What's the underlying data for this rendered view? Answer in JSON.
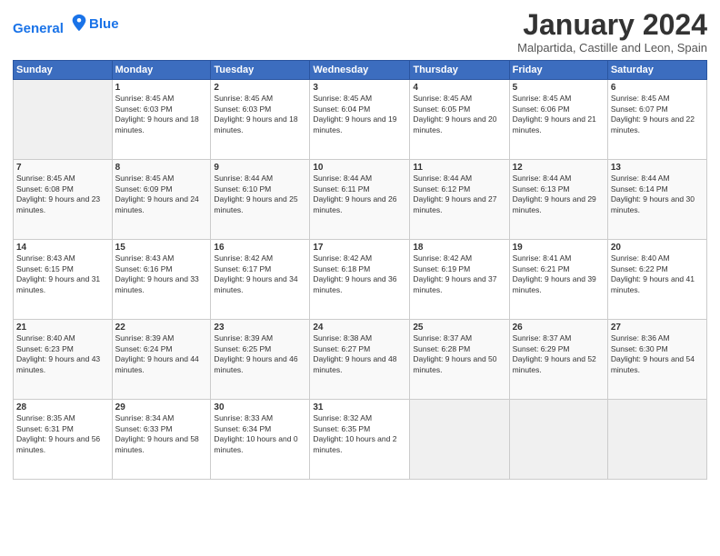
{
  "logo": {
    "line1": "General",
    "line2": "Blue"
  },
  "title": "January 2024",
  "subtitle": "Malpartida, Castille and Leon, Spain",
  "weekdays": [
    "Sunday",
    "Monday",
    "Tuesday",
    "Wednesday",
    "Thursday",
    "Friday",
    "Saturday"
  ],
  "weeks": [
    [
      {
        "day": "",
        "sunrise": "",
        "sunset": "",
        "daylight": ""
      },
      {
        "day": "1",
        "sunrise": "8:45 AM",
        "sunset": "6:03 PM",
        "daylight": "9 hours and 18 minutes."
      },
      {
        "day": "2",
        "sunrise": "8:45 AM",
        "sunset": "6:03 PM",
        "daylight": "9 hours and 18 minutes."
      },
      {
        "day": "3",
        "sunrise": "8:45 AM",
        "sunset": "6:04 PM",
        "daylight": "9 hours and 19 minutes."
      },
      {
        "day": "4",
        "sunrise": "8:45 AM",
        "sunset": "6:05 PM",
        "daylight": "9 hours and 20 minutes."
      },
      {
        "day": "5",
        "sunrise": "8:45 AM",
        "sunset": "6:06 PM",
        "daylight": "9 hours and 21 minutes."
      },
      {
        "day": "6",
        "sunrise": "8:45 AM",
        "sunset": "6:07 PM",
        "daylight": "9 hours and 22 minutes."
      }
    ],
    [
      {
        "day": "7",
        "sunrise": "8:45 AM",
        "sunset": "6:08 PM",
        "daylight": "9 hours and 23 minutes."
      },
      {
        "day": "8",
        "sunrise": "8:45 AM",
        "sunset": "6:09 PM",
        "daylight": "9 hours and 24 minutes."
      },
      {
        "day": "9",
        "sunrise": "8:44 AM",
        "sunset": "6:10 PM",
        "daylight": "9 hours and 25 minutes."
      },
      {
        "day": "10",
        "sunrise": "8:44 AM",
        "sunset": "6:11 PM",
        "daylight": "9 hours and 26 minutes."
      },
      {
        "day": "11",
        "sunrise": "8:44 AM",
        "sunset": "6:12 PM",
        "daylight": "9 hours and 27 minutes."
      },
      {
        "day": "12",
        "sunrise": "8:44 AM",
        "sunset": "6:13 PM",
        "daylight": "9 hours and 29 minutes."
      },
      {
        "day": "13",
        "sunrise": "8:44 AM",
        "sunset": "6:14 PM",
        "daylight": "9 hours and 30 minutes."
      }
    ],
    [
      {
        "day": "14",
        "sunrise": "8:43 AM",
        "sunset": "6:15 PM",
        "daylight": "9 hours and 31 minutes."
      },
      {
        "day": "15",
        "sunrise": "8:43 AM",
        "sunset": "6:16 PM",
        "daylight": "9 hours and 33 minutes."
      },
      {
        "day": "16",
        "sunrise": "8:42 AM",
        "sunset": "6:17 PM",
        "daylight": "9 hours and 34 minutes."
      },
      {
        "day": "17",
        "sunrise": "8:42 AM",
        "sunset": "6:18 PM",
        "daylight": "9 hours and 36 minutes."
      },
      {
        "day": "18",
        "sunrise": "8:42 AM",
        "sunset": "6:19 PM",
        "daylight": "9 hours and 37 minutes."
      },
      {
        "day": "19",
        "sunrise": "8:41 AM",
        "sunset": "6:21 PM",
        "daylight": "9 hours and 39 minutes."
      },
      {
        "day": "20",
        "sunrise": "8:40 AM",
        "sunset": "6:22 PM",
        "daylight": "9 hours and 41 minutes."
      }
    ],
    [
      {
        "day": "21",
        "sunrise": "8:40 AM",
        "sunset": "6:23 PM",
        "daylight": "9 hours and 43 minutes."
      },
      {
        "day": "22",
        "sunrise": "8:39 AM",
        "sunset": "6:24 PM",
        "daylight": "9 hours and 44 minutes."
      },
      {
        "day": "23",
        "sunrise": "8:39 AM",
        "sunset": "6:25 PM",
        "daylight": "9 hours and 46 minutes."
      },
      {
        "day": "24",
        "sunrise": "8:38 AM",
        "sunset": "6:27 PM",
        "daylight": "9 hours and 48 minutes."
      },
      {
        "day": "25",
        "sunrise": "8:37 AM",
        "sunset": "6:28 PM",
        "daylight": "9 hours and 50 minutes."
      },
      {
        "day": "26",
        "sunrise": "8:37 AM",
        "sunset": "6:29 PM",
        "daylight": "9 hours and 52 minutes."
      },
      {
        "day": "27",
        "sunrise": "8:36 AM",
        "sunset": "6:30 PM",
        "daylight": "9 hours and 54 minutes."
      }
    ],
    [
      {
        "day": "28",
        "sunrise": "8:35 AM",
        "sunset": "6:31 PM",
        "daylight": "9 hours and 56 minutes."
      },
      {
        "day": "29",
        "sunrise": "8:34 AM",
        "sunset": "6:33 PM",
        "daylight": "9 hours and 58 minutes."
      },
      {
        "day": "30",
        "sunrise": "8:33 AM",
        "sunset": "6:34 PM",
        "daylight": "10 hours and 0 minutes."
      },
      {
        "day": "31",
        "sunrise": "8:32 AM",
        "sunset": "6:35 PM",
        "daylight": "10 hours and 2 minutes."
      },
      {
        "day": "",
        "sunrise": "",
        "sunset": "",
        "daylight": ""
      },
      {
        "day": "",
        "sunrise": "",
        "sunset": "",
        "daylight": ""
      },
      {
        "day": "",
        "sunrise": "",
        "sunset": "",
        "daylight": ""
      }
    ]
  ]
}
